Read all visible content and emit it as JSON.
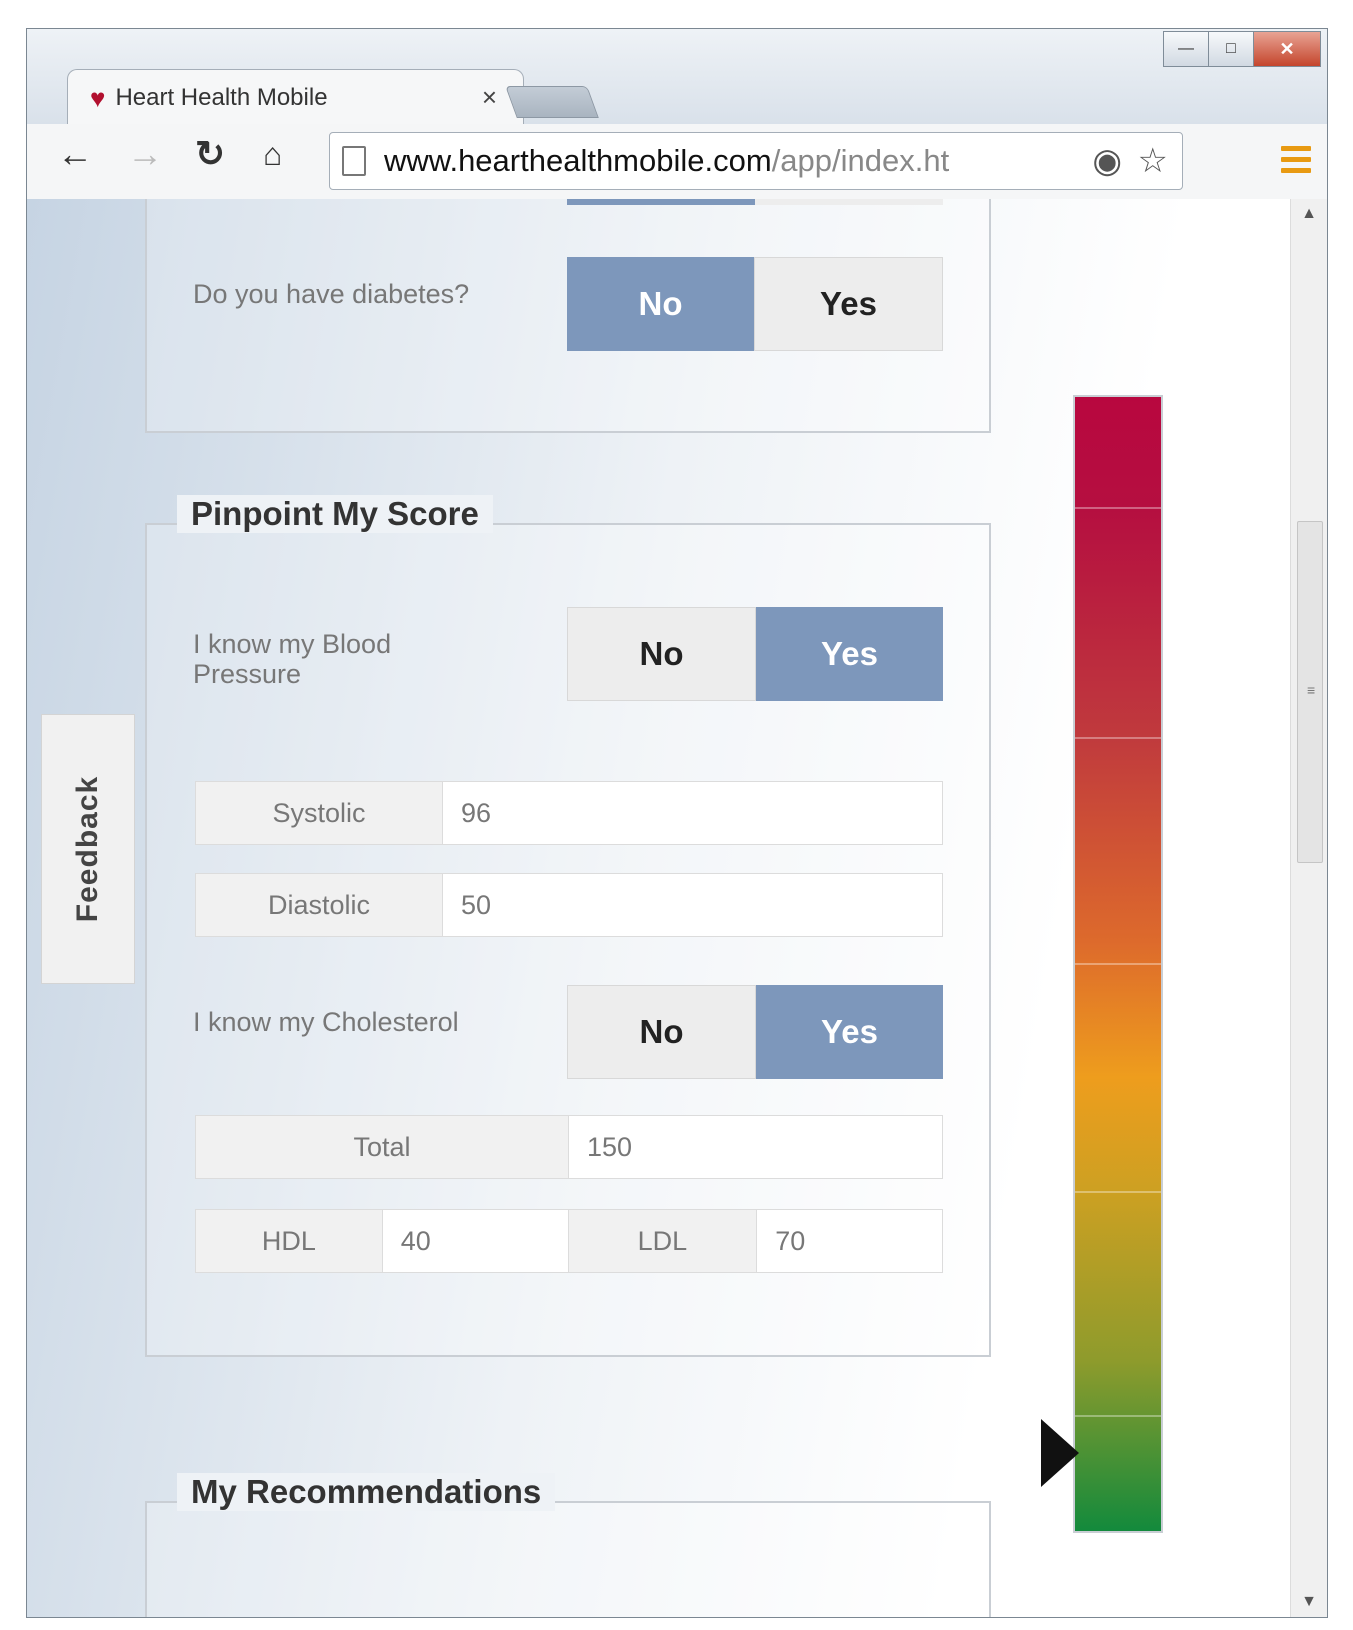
{
  "browser": {
    "tab_title": "Heart Health Mobile",
    "tab_close": "×",
    "url_host": "www.hearthealthmobile.com",
    "url_path": "/app/index.ht",
    "window_controls": {
      "minimize": "—",
      "maximize": "□",
      "close": "✕"
    }
  },
  "icons": {
    "back": "back-arrow-icon",
    "forward": "forward-arrow-icon",
    "reload": "reload-icon",
    "home": "home-icon",
    "page": "page-icon",
    "extension": "extension-icon",
    "bookmark": "star-icon",
    "menu": "hamburger-menu-icon"
  },
  "feedback_tab": "Feedback",
  "diabetes": {
    "question": "Do you have diabetes?",
    "no": "No",
    "yes": "Yes",
    "selected": "No"
  },
  "pinpoint": {
    "title": "Pinpoint My Score",
    "bp_question": "I know my Blood Pressure",
    "bp_no": "No",
    "bp_yes": "Yes",
    "bp_selected": "Yes",
    "systolic_label": "Systolic",
    "systolic_value": "96",
    "diastolic_label": "Diastolic",
    "diastolic_value": "50",
    "chol_question": "I know my Cholesterol",
    "chol_no": "No",
    "chol_yes": "Yes",
    "chol_selected": "Yes",
    "total_label": "Total",
    "total_value": "150",
    "hdl_label": "HDL",
    "hdl_value": "40",
    "ldl_label": "LDL",
    "ldl_value": "70"
  },
  "recommendations": {
    "title": "My Recommendations"
  },
  "risk_gauge": {
    "colors": [
      "#b8073f",
      "#c03a3d",
      "#dd6a2c",
      "#ee9d1d",
      "#8e9b2c",
      "#138a3c"
    ],
    "pointer_level": 0.07
  }
}
